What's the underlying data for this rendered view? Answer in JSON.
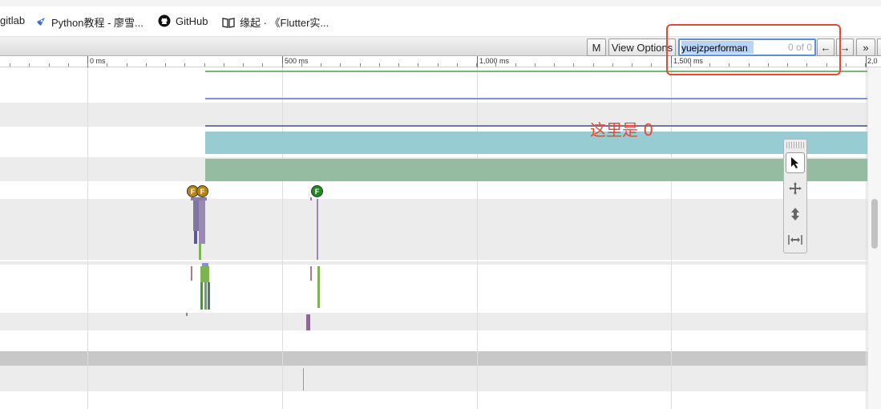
{
  "bookmarks": [
    {
      "label": "gitlab",
      "icon": "gitlab-icon"
    },
    {
      "label": "Python教程 - 廖雪...",
      "icon": "rocket-icon"
    },
    {
      "label": "GitHub",
      "icon": "github-icon"
    },
    {
      "label": "缘起 · 《Flutter实...",
      "icon": "book-icon"
    }
  ],
  "toolbar": {
    "m_label": "M",
    "view_options_label": "View Options",
    "search_value": "yuejzperforman",
    "search_count": "0 of 0",
    "prev_label": "←",
    "next_label": "→",
    "expand_label": "»"
  },
  "ruler": {
    "labels": [
      "0 ms",
      "500 ms",
      "1,000 ms",
      "1,500 ms",
      "2,0"
    ]
  },
  "flow_markers": [
    "F",
    "F",
    "F"
  ],
  "tools": [
    "selection-tool-icon",
    "pan-tool-icon",
    "zoom-tool-icon",
    "timing-tool-icon"
  ],
  "annotation": {
    "text": "这里是 0",
    "color": "#e8492e"
  },
  "colors": {
    "cyan_track": "#97cdd2",
    "green_track": "#95bca0",
    "purple_slice": "#8a7fa8",
    "green_slice": "#7db450"
  }
}
